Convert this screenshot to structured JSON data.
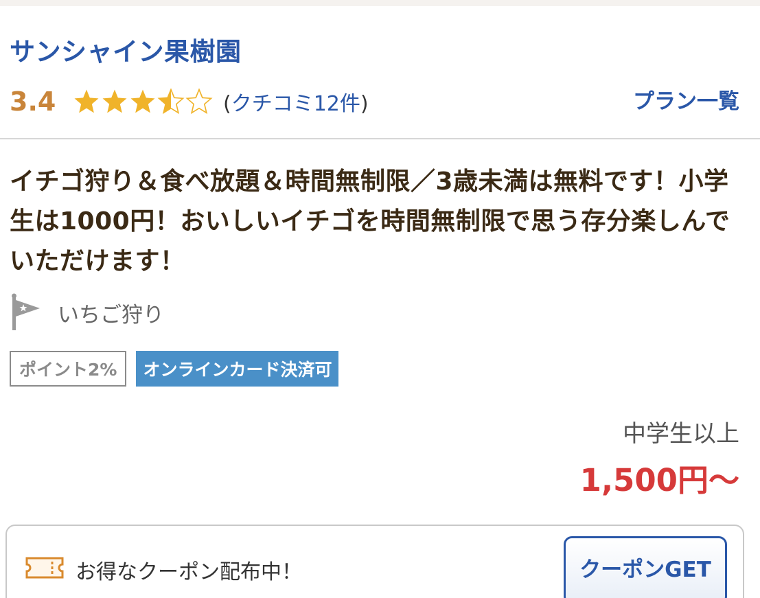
{
  "shop": {
    "name": "サンシャイン果樹園",
    "rating": {
      "score": "3.4",
      "stars_value": 3.5,
      "stars_max": 5,
      "review_open": "(",
      "review_text": "クチコミ12件",
      "review_close": ")"
    },
    "plan_list_label": "プラン一覧"
  },
  "plan": {
    "description": "イチゴ狩り＆食べ放題＆時間無制限／3歳未満は無料です！小学生は1000円！おいしいイチゴを時間無制限で思う存分楽しんでいただけます！",
    "category_label": "いちご狩り",
    "badges": {
      "point": "ポイント2%",
      "card": "オンラインカード決済可"
    },
    "price_label": "中学生以上",
    "price_value": "1,500円〜"
  },
  "coupon": {
    "text": "お得なクーポン配布中！",
    "button_label": "クーポンGET"
  },
  "colors": {
    "link_blue": "#2a57a8",
    "score_orange": "#c9853a",
    "star_gold": "#f0b32a",
    "price_red": "#d63a3a",
    "card_badge_blue": "#4a90c8"
  },
  "icons": {
    "category": "flag-icon",
    "coupon": "ticket-icon",
    "rating": "star-icon"
  }
}
